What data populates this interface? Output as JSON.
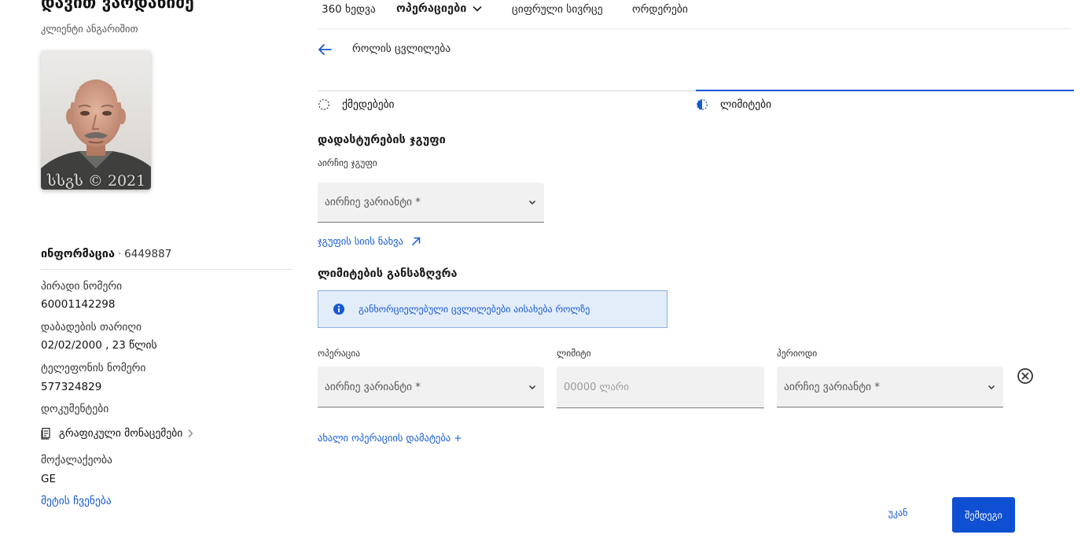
{
  "client": {
    "name": "დავით ვარდანიძე",
    "subtitle": "კლიენტი ანგარიშით",
    "photo_watermark": "სსგს © 2021"
  },
  "info": {
    "title": "ინფორმაცია",
    "separator": "·",
    "id": "6449887",
    "fields": [
      {
        "label": "პირადი ნომერი",
        "value": "60001142298"
      },
      {
        "label": "დაბადების თარიღი",
        "value": "02/02/2000 , 23 წლის"
      },
      {
        "label": "ტელეფონის ნომერი",
        "value": "577324829"
      },
      {
        "label": "დოკუმენტები"
      },
      {
        "label": "მოქალაქეობა",
        "value": "GE"
      }
    ],
    "documents_link": "გრაფიკული მონაცემები",
    "show_more": "მეტის ჩვენება"
  },
  "nav": {
    "items": [
      "360 ხედვა",
      "ოპერაციები",
      "ციფრული სივრცე",
      "ორდერები"
    ],
    "active_index": 1
  },
  "header": {
    "title": "როლის ცვლილება"
  },
  "steps": [
    {
      "label": "ქმედებები",
      "state": "pending"
    },
    {
      "label": "ლიმიტები",
      "state": "active"
    }
  ],
  "approval_group": {
    "title": "დადასტურების ჯგუფი",
    "label": "აირჩიე ჯგუფი",
    "select_placeholder": "აირჩიე ვარიანტი *",
    "view_list_link": "ჯგუფის სიის ნახვა"
  },
  "limits": {
    "title": "ლიმიტების განსაზღვრა",
    "info_message": "განხორციელებული ცვლილებები აისახება როლზე",
    "columns": {
      "operation": "ოპერაცია",
      "limit": "ლიმიტი",
      "period": "პერიოდი"
    },
    "row": {
      "operation_placeholder": "აირჩიე ვარიანტი *",
      "limit_placeholder": "00000 ლარი",
      "limit_value": "",
      "period_placeholder": "აირჩიე ვარიანტი *"
    },
    "add_operation_link": "ახალი ოპერაციის დამატება +"
  },
  "footer": {
    "back_label": "უკან",
    "next_label": "შემდეგი"
  },
  "colors": {
    "accent": "#1659d6",
    "primary_button": "#0f4fd1",
    "info_bg": "#e3edf9",
    "field_bg": "#f1f1f1"
  }
}
